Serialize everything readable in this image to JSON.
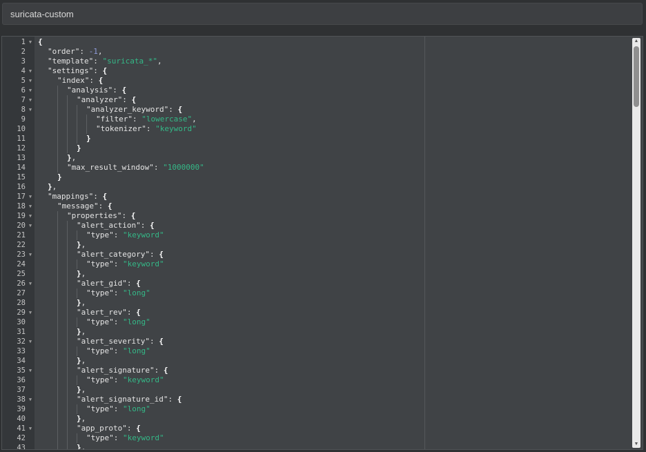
{
  "template_name": "suricata-custom",
  "scroll": {
    "thumb_start": 0.0,
    "thumb_fraction": 0.155
  },
  "editor": {
    "lines": [
      {
        "n": "1",
        "fold": true,
        "depth": 0,
        "tokens": [
          [
            "pun",
            "{"
          ]
        ]
      },
      {
        "n": "2",
        "fold": false,
        "depth": 1,
        "tokens": [
          [
            "key",
            "\"order\""
          ],
          [
            "cm",
            ": "
          ],
          [
            "num",
            "-1"
          ],
          [
            "cm",
            ","
          ]
        ]
      },
      {
        "n": "3",
        "fold": false,
        "depth": 1,
        "tokens": [
          [
            "key",
            "\"template\""
          ],
          [
            "cm",
            ": "
          ],
          [
            "str",
            "\"suricata_*\""
          ],
          [
            "cm",
            ","
          ]
        ]
      },
      {
        "n": "4",
        "fold": true,
        "depth": 1,
        "tokens": [
          [
            "key",
            "\"settings\""
          ],
          [
            "cm",
            ": "
          ],
          [
            "pun",
            "{"
          ]
        ]
      },
      {
        "n": "5",
        "fold": true,
        "depth": 2,
        "tokens": [
          [
            "key",
            "\"index\""
          ],
          [
            "cm",
            ": "
          ],
          [
            "pun",
            "{"
          ]
        ]
      },
      {
        "n": "6",
        "fold": true,
        "depth": 3,
        "tokens": [
          [
            "key",
            "\"analysis\""
          ],
          [
            "cm",
            ": "
          ],
          [
            "pun",
            "{"
          ]
        ]
      },
      {
        "n": "7",
        "fold": true,
        "depth": 4,
        "tokens": [
          [
            "key",
            "\"analyzer\""
          ],
          [
            "cm",
            ": "
          ],
          [
            "pun",
            "{"
          ]
        ]
      },
      {
        "n": "8",
        "fold": true,
        "depth": 5,
        "tokens": [
          [
            "key",
            "\"analyzer_keyword\""
          ],
          [
            "cm",
            ": "
          ],
          [
            "pun",
            "{"
          ]
        ]
      },
      {
        "n": "9",
        "fold": false,
        "depth": 6,
        "tokens": [
          [
            "key",
            "\"filter\""
          ],
          [
            "cm",
            ": "
          ],
          [
            "str",
            "\"lowercase\""
          ],
          [
            "cm",
            ","
          ]
        ]
      },
      {
        "n": "10",
        "fold": false,
        "depth": 6,
        "tokens": [
          [
            "key",
            "\"tokenizer\""
          ],
          [
            "cm",
            ": "
          ],
          [
            "str",
            "\"keyword\""
          ]
        ]
      },
      {
        "n": "11",
        "fold": false,
        "depth": 5,
        "tokens": [
          [
            "pun",
            "}"
          ]
        ]
      },
      {
        "n": "12",
        "fold": false,
        "depth": 4,
        "tokens": [
          [
            "pun",
            "}"
          ]
        ]
      },
      {
        "n": "13",
        "fold": false,
        "depth": 3,
        "tokens": [
          [
            "pun",
            "}"
          ],
          [
            "cm",
            ","
          ]
        ]
      },
      {
        "n": "14",
        "fold": false,
        "depth": 3,
        "tokens": [
          [
            "key",
            "\"max_result_window\""
          ],
          [
            "cm",
            ": "
          ],
          [
            "str",
            "\"1000000\""
          ]
        ]
      },
      {
        "n": "15",
        "fold": false,
        "depth": 2,
        "tokens": [
          [
            "pun",
            "}"
          ]
        ]
      },
      {
        "n": "16",
        "fold": false,
        "depth": 1,
        "tokens": [
          [
            "pun",
            "}"
          ],
          [
            "cm",
            ","
          ]
        ]
      },
      {
        "n": "17",
        "fold": true,
        "depth": 1,
        "tokens": [
          [
            "key",
            "\"mappings\""
          ],
          [
            "cm",
            ": "
          ],
          [
            "pun",
            "{"
          ]
        ]
      },
      {
        "n": "18",
        "fold": true,
        "depth": 2,
        "tokens": [
          [
            "key",
            "\"message\""
          ],
          [
            "cm",
            ": "
          ],
          [
            "pun",
            "{"
          ]
        ]
      },
      {
        "n": "19",
        "fold": true,
        "depth": 3,
        "tokens": [
          [
            "key",
            "\"properties\""
          ],
          [
            "cm",
            ": "
          ],
          [
            "pun",
            "{"
          ]
        ]
      },
      {
        "n": "20",
        "fold": true,
        "depth": 4,
        "tokens": [
          [
            "key",
            "\"alert_action\""
          ],
          [
            "cm",
            ": "
          ],
          [
            "pun",
            "{"
          ]
        ]
      },
      {
        "n": "21",
        "fold": false,
        "depth": 5,
        "tokens": [
          [
            "key",
            "\"type\""
          ],
          [
            "cm",
            ": "
          ],
          [
            "str",
            "\"keyword\""
          ]
        ]
      },
      {
        "n": "22",
        "fold": false,
        "depth": 4,
        "tokens": [
          [
            "pun",
            "}"
          ],
          [
            "cm",
            ","
          ]
        ]
      },
      {
        "n": "23",
        "fold": true,
        "depth": 4,
        "tokens": [
          [
            "key",
            "\"alert_category\""
          ],
          [
            "cm",
            ": "
          ],
          [
            "pun",
            "{"
          ]
        ]
      },
      {
        "n": "24",
        "fold": false,
        "depth": 5,
        "tokens": [
          [
            "key",
            "\"type\""
          ],
          [
            "cm",
            ": "
          ],
          [
            "str",
            "\"keyword\""
          ]
        ]
      },
      {
        "n": "25",
        "fold": false,
        "depth": 4,
        "tokens": [
          [
            "pun",
            "}"
          ],
          [
            "cm",
            ","
          ]
        ]
      },
      {
        "n": "26",
        "fold": true,
        "depth": 4,
        "tokens": [
          [
            "key",
            "\"alert_gid\""
          ],
          [
            "cm",
            ": "
          ],
          [
            "pun",
            "{"
          ]
        ]
      },
      {
        "n": "27",
        "fold": false,
        "depth": 5,
        "tokens": [
          [
            "key",
            "\"type\""
          ],
          [
            "cm",
            ": "
          ],
          [
            "str",
            "\"long\""
          ]
        ]
      },
      {
        "n": "28",
        "fold": false,
        "depth": 4,
        "tokens": [
          [
            "pun",
            "}"
          ],
          [
            "cm",
            ","
          ]
        ]
      },
      {
        "n": "29",
        "fold": true,
        "depth": 4,
        "tokens": [
          [
            "key",
            "\"alert_rev\""
          ],
          [
            "cm",
            ": "
          ],
          [
            "pun",
            "{"
          ]
        ]
      },
      {
        "n": "30",
        "fold": false,
        "depth": 5,
        "tokens": [
          [
            "key",
            "\"type\""
          ],
          [
            "cm",
            ": "
          ],
          [
            "str",
            "\"long\""
          ]
        ]
      },
      {
        "n": "31",
        "fold": false,
        "depth": 4,
        "tokens": [
          [
            "pun",
            "}"
          ],
          [
            "cm",
            ","
          ]
        ]
      },
      {
        "n": "32",
        "fold": true,
        "depth": 4,
        "tokens": [
          [
            "key",
            "\"alert_severity\""
          ],
          [
            "cm",
            ": "
          ],
          [
            "pun",
            "{"
          ]
        ]
      },
      {
        "n": "33",
        "fold": false,
        "depth": 5,
        "tokens": [
          [
            "key",
            "\"type\""
          ],
          [
            "cm",
            ": "
          ],
          [
            "str",
            "\"long\""
          ]
        ]
      },
      {
        "n": "34",
        "fold": false,
        "depth": 4,
        "tokens": [
          [
            "pun",
            "}"
          ],
          [
            "cm",
            ","
          ]
        ]
      },
      {
        "n": "35",
        "fold": true,
        "depth": 4,
        "tokens": [
          [
            "key",
            "\"alert_signature\""
          ],
          [
            "cm",
            ": "
          ],
          [
            "pun",
            "{"
          ]
        ]
      },
      {
        "n": "36",
        "fold": false,
        "depth": 5,
        "tokens": [
          [
            "key",
            "\"type\""
          ],
          [
            "cm",
            ": "
          ],
          [
            "str",
            "\"keyword\""
          ]
        ]
      },
      {
        "n": "37",
        "fold": false,
        "depth": 4,
        "tokens": [
          [
            "pun",
            "}"
          ],
          [
            "cm",
            ","
          ]
        ]
      },
      {
        "n": "38",
        "fold": true,
        "depth": 4,
        "tokens": [
          [
            "key",
            "\"alert_signature_id\""
          ],
          [
            "cm",
            ": "
          ],
          [
            "pun",
            "{"
          ]
        ]
      },
      {
        "n": "39",
        "fold": false,
        "depth": 5,
        "tokens": [
          [
            "key",
            "\"type\""
          ],
          [
            "cm",
            ": "
          ],
          [
            "str",
            "\"long\""
          ]
        ]
      },
      {
        "n": "40",
        "fold": false,
        "depth": 4,
        "tokens": [
          [
            "pun",
            "}"
          ],
          [
            "cm",
            ","
          ]
        ]
      },
      {
        "n": "41",
        "fold": true,
        "depth": 4,
        "tokens": [
          [
            "key",
            "\"app_proto\""
          ],
          [
            "cm",
            ": "
          ],
          [
            "pun",
            "{"
          ]
        ]
      },
      {
        "n": "42",
        "fold": false,
        "depth": 5,
        "tokens": [
          [
            "key",
            "\"type\""
          ],
          [
            "cm",
            ": "
          ],
          [
            "str",
            "\"keyword\""
          ]
        ]
      },
      {
        "n": "43",
        "fold": false,
        "depth": 4,
        "tokens": [
          [
            "pun",
            "}"
          ],
          [
            "cm",
            ","
          ]
        ]
      }
    ]
  }
}
